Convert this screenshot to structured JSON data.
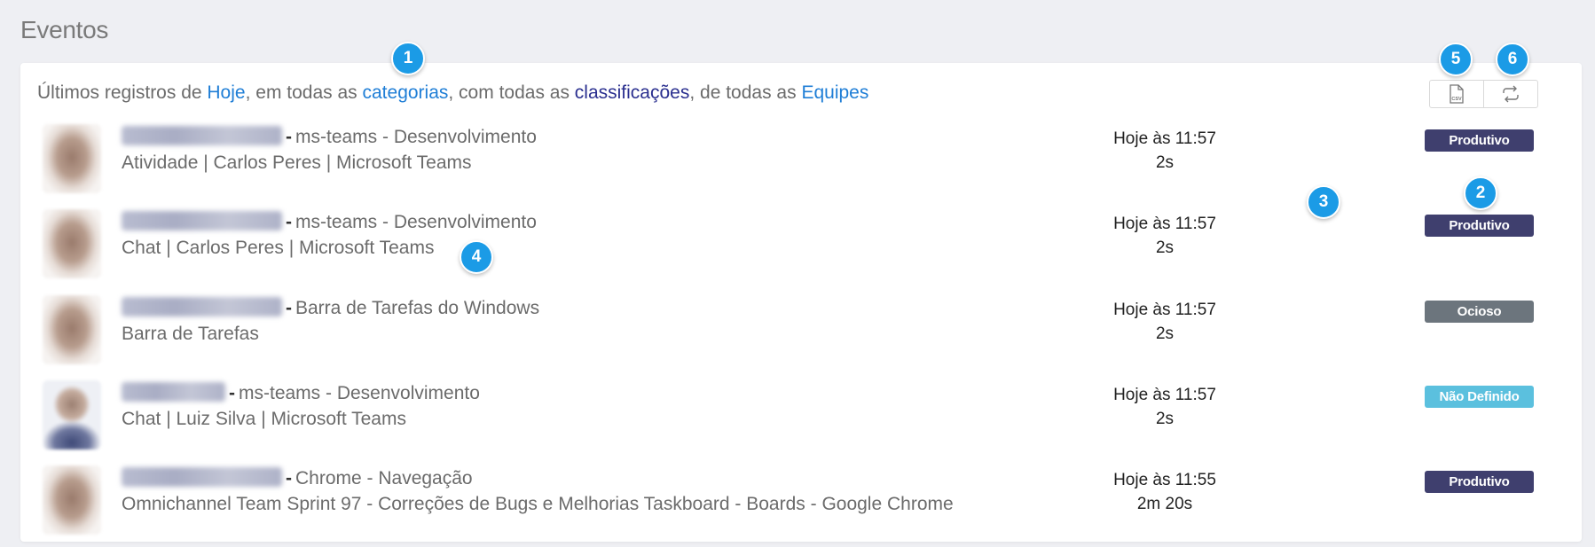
{
  "page": {
    "title": "Eventos"
  },
  "filter": {
    "prefix": "Últimos registros de ",
    "period": "Hoje",
    "sep1": ", em todas as ",
    "categories": "categorias",
    "sep2": ", com todas as ",
    "classifications": "classificações",
    "sep3": ", de todas as ",
    "teams": "Equipes"
  },
  "toolbar": {
    "csv_icon": "file-csv-icon",
    "refresh_icon": "refresh-icon"
  },
  "events": [
    {
      "app": "ms-teams - Desenvolvimento",
      "detail": "Atividade | Carlos Peres | Microsoft Teams",
      "time": "Hoje às 11:57",
      "duration": "2s",
      "status": "Produtivo"
    },
    {
      "app": "ms-teams - Desenvolvimento",
      "detail": "Chat | Carlos Peres | Microsoft Teams",
      "time": "Hoje às 11:57",
      "duration": "2s",
      "status": "Produtivo"
    },
    {
      "app": "Barra de Tarefas do Windows",
      "detail": "Barra de Tarefas",
      "time": "Hoje às 11:57",
      "duration": "2s",
      "status": "Ocioso"
    },
    {
      "app": "ms-teams - Desenvolvimento",
      "detail": "Chat | Luiz Silva | Microsoft Teams",
      "time": "Hoje às 11:57",
      "duration": "2s",
      "status": "Não Definido"
    },
    {
      "app": "Chrome - Navegação",
      "detail": "Omnichannel Team Sprint 97 - Correções de Bugs e Melhorias Taskboard - Boards - Google Chrome",
      "time": "Hoje às 11:55",
      "duration": "2m 20s",
      "status": "Produtivo"
    }
  ],
  "status_colors": {
    "Produtivo": "#3f3f6e",
    "Ocioso": "#6c757d",
    "Não Definido": "#5bc0de"
  },
  "callouts": [
    "1",
    "2",
    "3",
    "4",
    "5",
    "6"
  ]
}
